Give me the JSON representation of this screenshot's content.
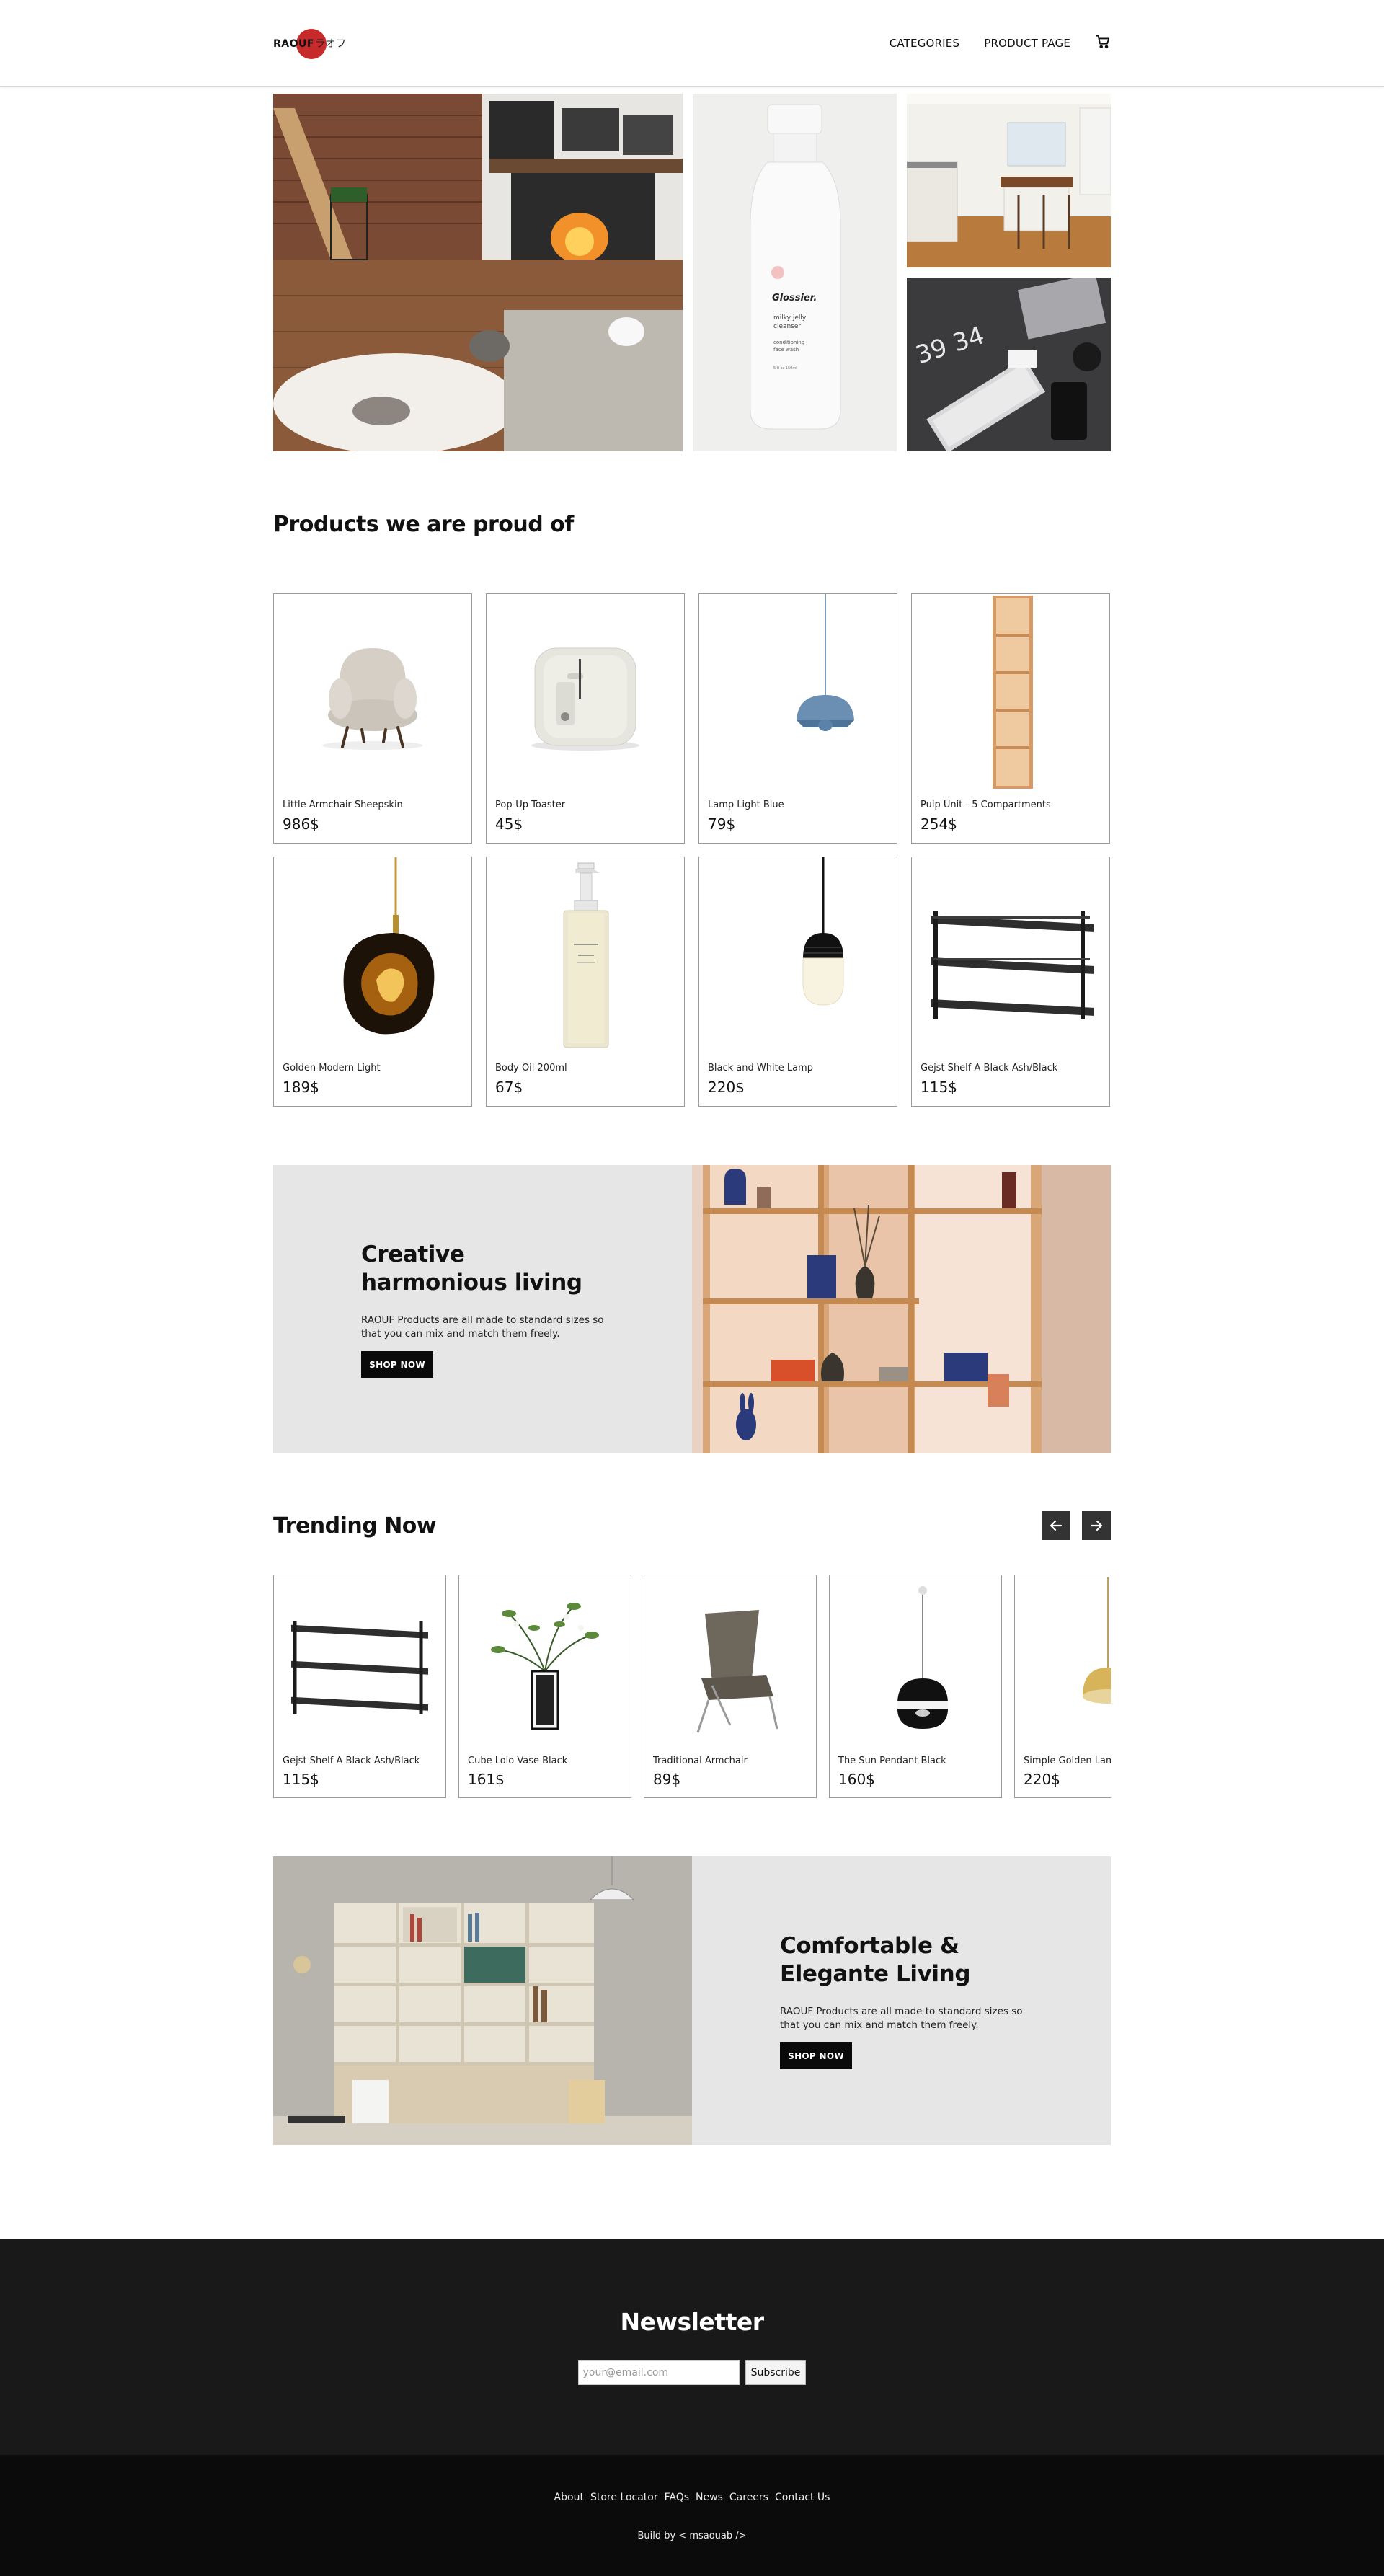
{
  "header": {
    "logo_text": "RAOUF",
    "logo_jp": "ラオフ",
    "nav": [
      {
        "label": "CATEGORIES"
      },
      {
        "label": "PRODUCT PAGE"
      }
    ]
  },
  "hero": {
    "tiles": [
      {
        "subject": "living room with fireplace and cat"
      },
      {
        "subject": "Glossier milky jelly cleanser bottle",
        "bottle_lines": [
          "Glossier.",
          "milky jelly",
          "cleanser",
          "conditioning",
          "face wash",
          "5 fl oz  150ml"
        ]
      },
      {
        "subject": "kitchen interior"
      },
      {
        "subject": "desk with keyboard and laptop",
        "chalk_text": "39 34"
      }
    ]
  },
  "proud": {
    "title": "Products we are proud of",
    "products": [
      {
        "name": "Little Armchair Sheepskin",
        "price": "986$"
      },
      {
        "name": "Pop-Up Toaster",
        "price": "45$"
      },
      {
        "name": "Lamp Light Blue",
        "price": "79$"
      },
      {
        "name": "Pulp Unit - 5 Compartments",
        "price": "254$"
      },
      {
        "name": "Golden Modern Light",
        "price": "189$"
      },
      {
        "name": "Body Oil 200ml",
        "price": "67$"
      },
      {
        "name": "Black and White Lamp",
        "price": "220$"
      },
      {
        "name": "Gejst Shelf A Black Ash/Black",
        "price": "115$"
      }
    ]
  },
  "banner1": {
    "title": "Creative harmonious living",
    "text": "RAOUF Products are all made to standard sizes so that you can mix and match them freely.",
    "button": "SHOP NOW"
  },
  "trending": {
    "title": "Trending Now",
    "items": [
      {
        "name": "Gejst Shelf A Black Ash/Black",
        "price": "115$"
      },
      {
        "name": "Cube Lolo Vase Black",
        "price": "161$"
      },
      {
        "name": "Traditional Armchair",
        "price": "89$"
      },
      {
        "name": "The Sun Pendant Black",
        "price": "160$"
      },
      {
        "name": "Simple Golden Lamp",
        "price": "220$"
      }
    ]
  },
  "banner2": {
    "title": "Comfortable & Elegante Living",
    "text": "RAOUF Products are all made to standard sizes so that you can mix and match them freely.",
    "button": "SHOP NOW"
  },
  "newsletter": {
    "title": "Newsletter",
    "placeholder": "your@email.com",
    "button": "Subscribe"
  },
  "footer": {
    "links": [
      "About",
      "Store Locator",
      "FAQs",
      "News",
      "Careers",
      "Contact Us"
    ],
    "credit": "Build by < msaouab />"
  },
  "colors": {
    "brand_red": "#c62a2a",
    "banner_bg": "#e6e6e6",
    "dark": "#191919",
    "footer": "#0b0b0b"
  }
}
